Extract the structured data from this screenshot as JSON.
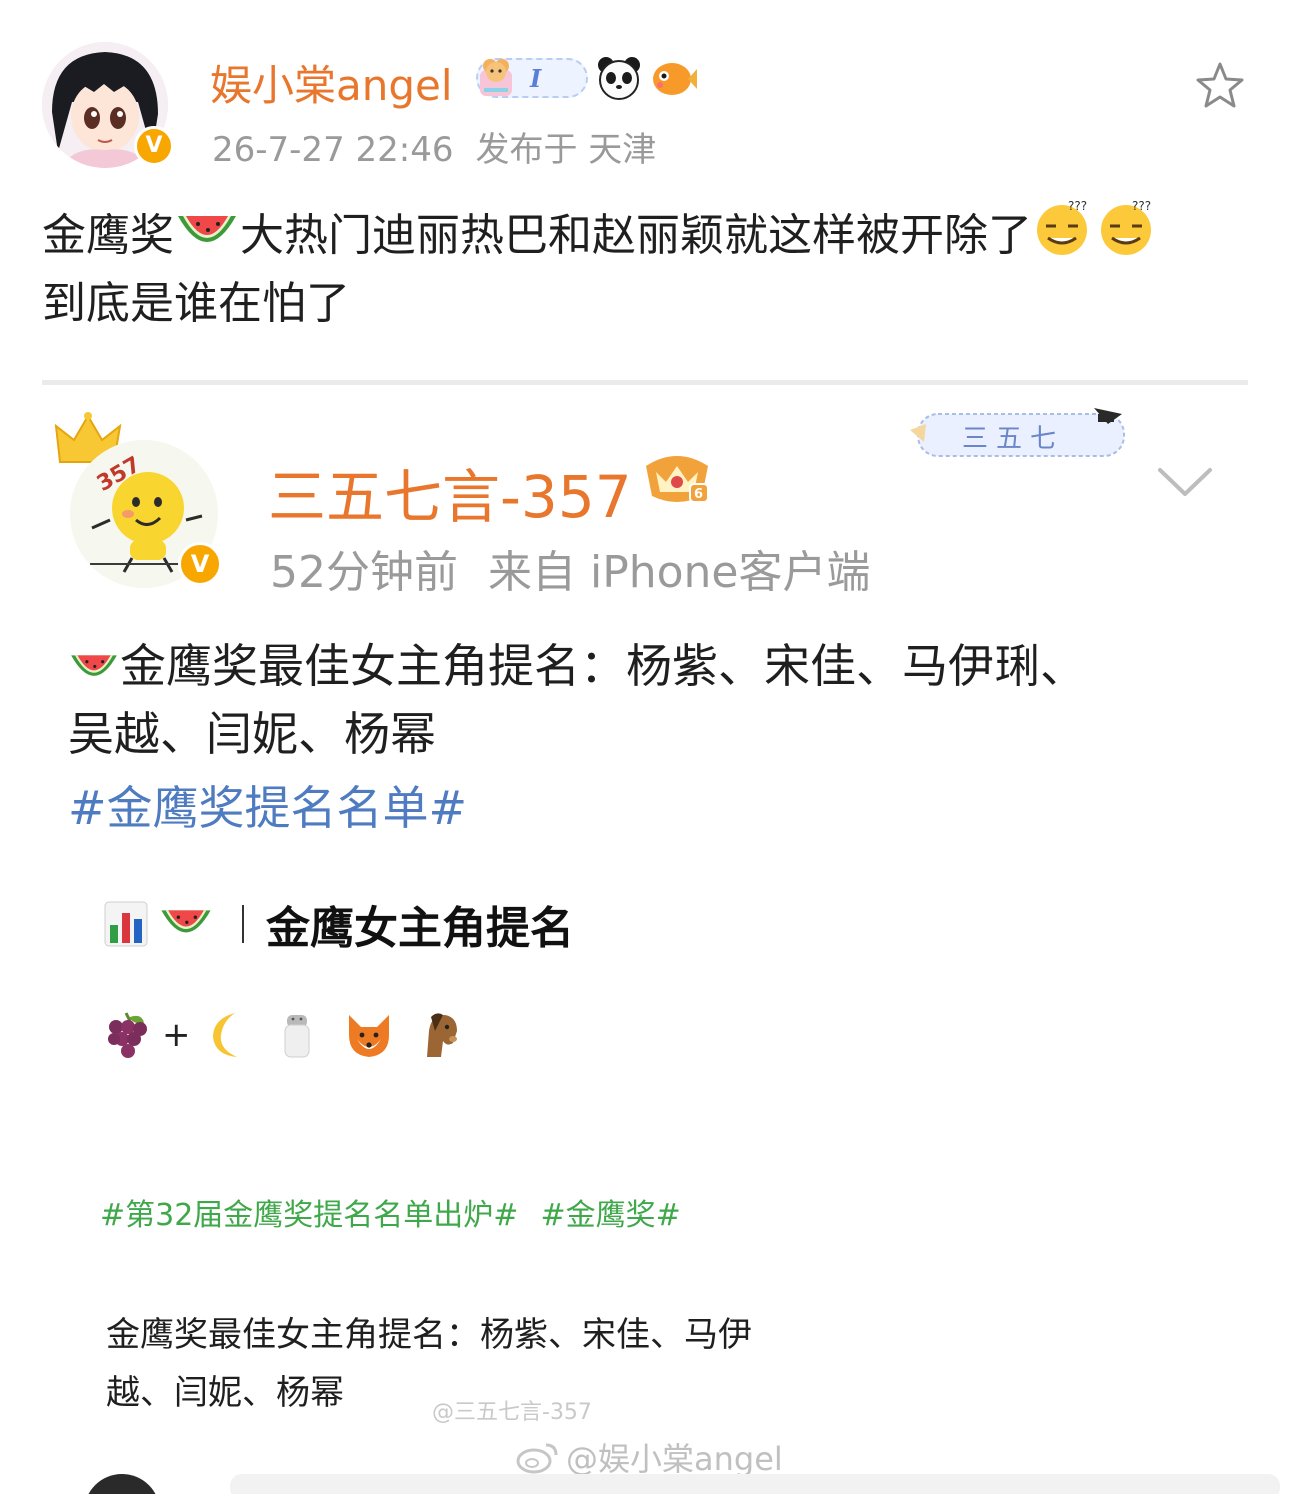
{
  "post": {
    "username": "娱小棠angel",
    "badge_text": "I",
    "timestamp": "26-7-27 22:46",
    "location": "发布于 天津",
    "text_line1": "金鹰奖",
    "text_line1_b": "大热门迪丽热巴和赵丽颖就这样被开除了",
    "text_line2": "到底是谁在怕了"
  },
  "quoted": {
    "username": "三五七言-357",
    "tag_badge": "三五七",
    "avatar_label": "357",
    "time": "52分钟前",
    "source": "来自 iPhone客户端",
    "text_line1": "金鹰奖最佳女主角提名：杨紫、宋佳、马伊琍、",
    "text_line2": "吴越、闫妮、杨幂",
    "hashtag": "#金鹰奖提名名单#"
  },
  "image": {
    "title": "金鹰女主角提名",
    "plus": "+",
    "tag1": "#第32届金鹰奖提名名单出炉#",
    "tag2": "#金鹰奖#",
    "line1": "金鹰奖最佳女主角提名：杨紫、宋佳、马伊",
    "line2": "越、闫妮、杨幂"
  },
  "watermarks": {
    "inner": "@三五七言-357",
    "outer": "@娱小棠angel"
  },
  "colors": {
    "username": "#e8762d",
    "link": "#4f7cc1",
    "green_tag": "#3fa84a",
    "meta_gray": "#9a9a9a",
    "verified": "#f7a700"
  },
  "icons": [
    "star-icon",
    "chevron-down-icon",
    "watermelon-icon",
    "grape-icon",
    "moon-icon",
    "salt-icon",
    "fox-icon",
    "horse-icon",
    "chart-icon",
    "weibo-logo-icon",
    "thinking-face-icon"
  ]
}
